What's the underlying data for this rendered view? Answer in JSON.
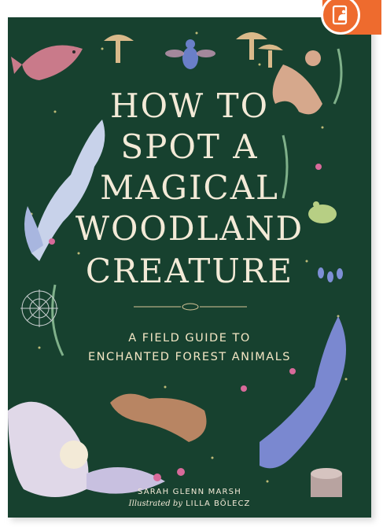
{
  "book": {
    "title_lines": [
      "HOW TO",
      "SPOT A",
      "MAGICAL",
      "WOODLAND",
      "CREATURE"
    ],
    "subtitle_lines": [
      "A FIELD GUIDE TO",
      "ENCHANTED FOREST ANIMALS"
    ],
    "author": "SARAH GLENN MARSH",
    "illustrated_by_label": "Illustrated by",
    "illustrator": "LILLA BÖLECZ"
  },
  "badge": {
    "icon": "ebook-reader-icon"
  },
  "colors": {
    "cover_bg": "#17412f",
    "title_text": "#f3ead7",
    "badge": "#ee6b2e"
  }
}
